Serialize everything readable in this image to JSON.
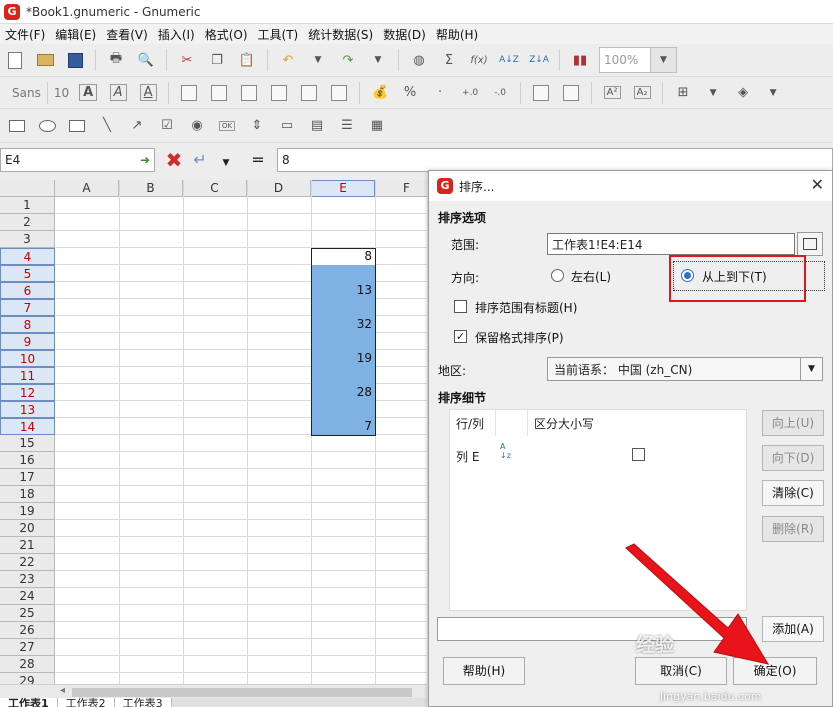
{
  "window": {
    "title": "*Book1.gnumeric - Gnumeric"
  },
  "menu": [
    "文件(F)",
    "编辑(E)",
    "查看(V)",
    "插入(I)",
    "格式(O)",
    "工具(T)",
    "统计数据(S)",
    "数据(D)",
    "帮助(H)"
  ],
  "toolbar": {
    "zoom": "100%",
    "font_name": "Sans",
    "font_size": "10",
    "fx": "f(x)"
  },
  "formula": {
    "cell_ref": "E4",
    "equals": "=",
    "value": "8"
  },
  "grid": {
    "columns": [
      "A",
      "B",
      "C",
      "D",
      "E",
      "F"
    ],
    "rows": [
      "1",
      "2",
      "3",
      "4",
      "5",
      "6",
      "7",
      "8",
      "9",
      "10",
      "11",
      "12",
      "13",
      "14",
      "15",
      "16",
      "17",
      "18",
      "19",
      "20",
      "21",
      "22",
      "23",
      "24",
      "25",
      "26",
      "27",
      "28",
      "29"
    ],
    "cells_e": [
      {
        "row": 4,
        "value": "8"
      },
      {
        "row": 6,
        "value": "13"
      },
      {
        "row": 8,
        "value": "32"
      },
      {
        "row": 10,
        "value": "19"
      },
      {
        "row": 12,
        "value": "28"
      },
      {
        "row": 14,
        "value": "7"
      }
    ],
    "sheet_tabs": [
      "工作表1",
      "工作表2",
      "工作表3"
    ]
  },
  "dialog": {
    "title": "排序...",
    "section_options": "排序选项",
    "range_label": "范围:",
    "range_value": "工作表1!E4:E14",
    "direction_label": "方向:",
    "dir_lr": "左右(L)",
    "dir_tb": "从上到下(T)",
    "has_header": "排序范围有标题(H)",
    "keep_format": "保留格式排序(P)",
    "locale_label": "地区:",
    "locale_value": "当前语系：  中国 (zh_CN)",
    "section_details": "排序细节",
    "col_header_rowcol": "行/列",
    "col_header_case": "区分大小写",
    "row_label": "列 E",
    "btn_up": "向上(U)",
    "btn_down": "向下(D)",
    "btn_clear": "清除(C)",
    "btn_delete": "删除(R)",
    "btn_add": "添加(A)",
    "btn_help": "帮助(H)",
    "btn_cancel": "取消(C)",
    "btn_ok": "确定(O)"
  },
  "watermark": {
    "main": "经验",
    "url": "jingyan.baidu.com"
  },
  "colors": {
    "selection": "#7fb1e3",
    "highlight": "#e0161b",
    "arrow": "#e8141a"
  }
}
